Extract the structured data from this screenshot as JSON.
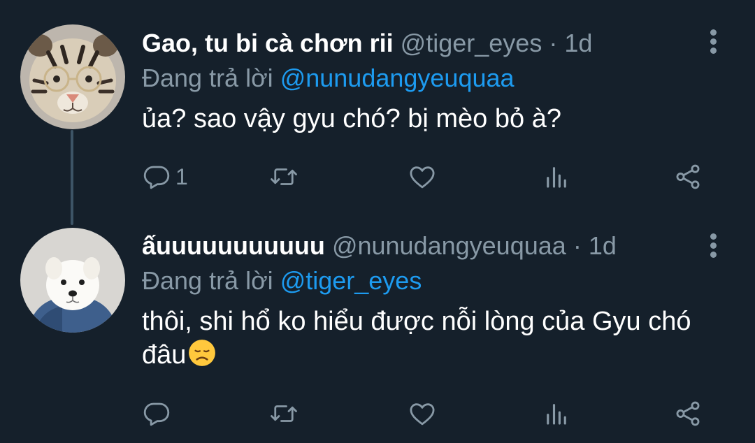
{
  "tweets": [
    {
      "display_name": "Gao, tu bi cà chơn rii",
      "handle": "@tiger_eyes",
      "separator": "·",
      "time": "1d",
      "reply_prefix": "Đang trả lời ",
      "reply_to": "@nunudangyeuquaa",
      "text": "ủa? sao vậy gyu chó? bị mèo bỏ à?",
      "reply_count": "1",
      "avatar_icon": "tiger-plush-with-glasses"
    },
    {
      "display_name": "ấuuuuuuuuuuu",
      "handle": "@nunudangyeuquaa",
      "separator": "·",
      "time": "1d",
      "reply_prefix": "Đang trả lời ",
      "reply_to": "@tiger_eyes",
      "text_line1": "thôi, shi hổ ko hiểu được nỗi lòng của Gyu chó",
      "text_line2": "đâu",
      "text_emoji": "disappointed-face",
      "reply_count": "",
      "avatar_icon": "white-samoyed-dog"
    }
  ],
  "colors": {
    "background": "#15202b",
    "primary_text": "#ffffff",
    "secondary_text": "#8899a6",
    "link": "#1d9bf0",
    "thread_line": "#3d5466"
  },
  "action_icons": [
    "reply-icon",
    "retweet-icon",
    "like-icon",
    "analytics-icon",
    "share-icon"
  ]
}
